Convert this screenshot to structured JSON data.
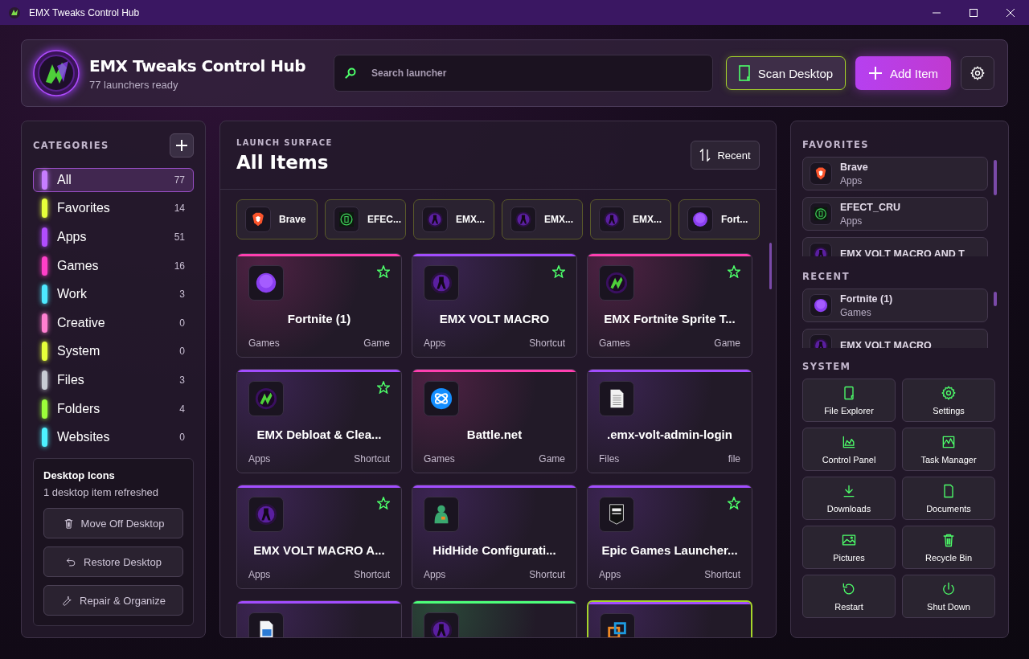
{
  "window": {
    "title": "EMX Tweaks Control Hub"
  },
  "header": {
    "title": "EMX Tweaks Control Hub",
    "subtitle": "77 launchers ready",
    "search_placeholder": "Search launcher",
    "scan_label": "Scan Desktop",
    "add_label": "Add Item"
  },
  "categories": {
    "heading": "CATEGORIES",
    "items": [
      {
        "label": "All",
        "count": "77",
        "color": "#c77dff",
        "selected": true
      },
      {
        "label": "Favorites",
        "count": "14",
        "color": "#e6ff3a",
        "selected": false
      },
      {
        "label": "Apps",
        "count": "51",
        "color": "#b14dff",
        "selected": false
      },
      {
        "label": "Games",
        "count": "16",
        "color": "#ff3fc8",
        "selected": false
      },
      {
        "label": "Work",
        "count": "3",
        "color": "#4de8ff",
        "selected": false
      },
      {
        "label": "Creative",
        "count": "0",
        "color": "#ff7fd0",
        "selected": false
      },
      {
        "label": "System",
        "count": "0",
        "color": "#e6ff3a",
        "selected": false
      },
      {
        "label": "Files",
        "count": "3",
        "color": "#c8ccd4",
        "selected": false
      },
      {
        "label": "Folders",
        "count": "4",
        "color": "#9cff3a",
        "selected": false
      },
      {
        "label": "Websites",
        "count": "0",
        "color": "#4df2ff",
        "selected": false
      }
    ]
  },
  "desktop_icons": {
    "title": "Desktop Icons",
    "status": "1 desktop item refreshed",
    "actions": [
      {
        "label": "Move Off Desktop",
        "kind": "trash"
      },
      {
        "label": "Restore Desktop",
        "kind": "undo"
      },
      {
        "label": "Repair & Organize",
        "kind": "wrench"
      }
    ]
  },
  "surface": {
    "eyebrow": "LAUNCH SURFACE",
    "title": "All Items",
    "sort_label": "Recent",
    "chips": [
      {
        "label": "Brave",
        "kind": "brave"
      },
      {
        "label": "EFEC...",
        "kind": "efect"
      },
      {
        "label": "EMX...",
        "kind": "emx"
      },
      {
        "label": "EMX...",
        "kind": "emx"
      },
      {
        "label": "EMX...",
        "kind": "emx"
      },
      {
        "label": "Fort...",
        "kind": "fortnite"
      }
    ],
    "cards": [
      {
        "title": "Fortnite (1)",
        "category": "Games",
        "type": "Game",
        "kind": "fortnite",
        "color": "#ff3fb0",
        "favorite": true,
        "selected": false
      },
      {
        "title": "EMX VOLT MACRO",
        "category": "Apps",
        "type": "Shortcut",
        "kind": "emx",
        "color": "#a24dff",
        "favorite": true,
        "selected": false
      },
      {
        "title": "EMX Fortnite Sprite T...",
        "category": "Games",
        "type": "Game",
        "kind": "emxlogo",
        "color": "#ff3fb0",
        "favorite": true,
        "selected": false
      },
      {
        "title": "EMX Debloat & Clea...",
        "category": "Apps",
        "type": "Shortcut",
        "kind": "emxlogo",
        "color": "#a24dff",
        "favorite": true,
        "selected": false
      },
      {
        "title": "Battle.net",
        "category": "Games",
        "type": "Game",
        "kind": "battlenet",
        "color": "#ff3fb0",
        "favorite": false,
        "selected": false
      },
      {
        "title": ".emx-volt-admin-login",
        "category": "Files",
        "type": "file",
        "kind": "document",
        "color": "#a24dff",
        "favorite": false,
        "selected": false
      },
      {
        "title": "EMX VOLT MACRO A...",
        "category": "Apps",
        "type": "Shortcut",
        "kind": "emx",
        "color": "#a24dff",
        "favorite": true,
        "selected": false
      },
      {
        "title": "HidHide Configurati...",
        "category": "Apps",
        "type": "Shortcut",
        "kind": "hidhide",
        "color": "#a24dff",
        "favorite": false,
        "selected": false
      },
      {
        "title": "Epic Games Launcher...",
        "category": "Apps",
        "type": "Shortcut",
        "kind": "epic",
        "color": "#a24dff",
        "favorite": true,
        "selected": false
      },
      {
        "kind": "script",
        "color": "#a24dff",
        "favorite": false,
        "selected": false
      },
      {
        "kind": "emx",
        "color": "#4dff7a",
        "favorite": false,
        "selected": false
      },
      {
        "kind": "vmware",
        "color": "#a24dff",
        "favorite": false,
        "selected": true
      }
    ]
  },
  "favorites": {
    "heading": "FAVORITES",
    "items": [
      {
        "name": "Brave",
        "category": "Apps",
        "kind": "brave"
      },
      {
        "name": "EFECT_CRU",
        "category": "Apps",
        "kind": "efect"
      },
      {
        "name": "EMX VOLT MACRO AND T",
        "kind": "emx"
      }
    ]
  },
  "recent": {
    "heading": "RECENT",
    "items": [
      {
        "name": "Fortnite (1)",
        "category": "Games",
        "kind": "fortnite"
      },
      {
        "name": "EMX VOLT MACRO",
        "kind": "emx"
      }
    ]
  },
  "system": {
    "heading": "SYSTEM",
    "items": [
      {
        "label": "File Explorer",
        "kind": "explorer"
      },
      {
        "label": "Settings",
        "kind": "gear"
      },
      {
        "label": "Control Panel",
        "kind": "areachart"
      },
      {
        "label": "Task Manager",
        "kind": "pulse"
      },
      {
        "label": "Downloads",
        "kind": "download"
      },
      {
        "label": "Documents",
        "kind": "page"
      },
      {
        "label": "Pictures",
        "kind": "image"
      },
      {
        "label": "Recycle Bin",
        "kind": "trash"
      },
      {
        "label": "Restart",
        "kind": "restart"
      },
      {
        "label": "Shut Down",
        "kind": "power"
      }
    ]
  }
}
